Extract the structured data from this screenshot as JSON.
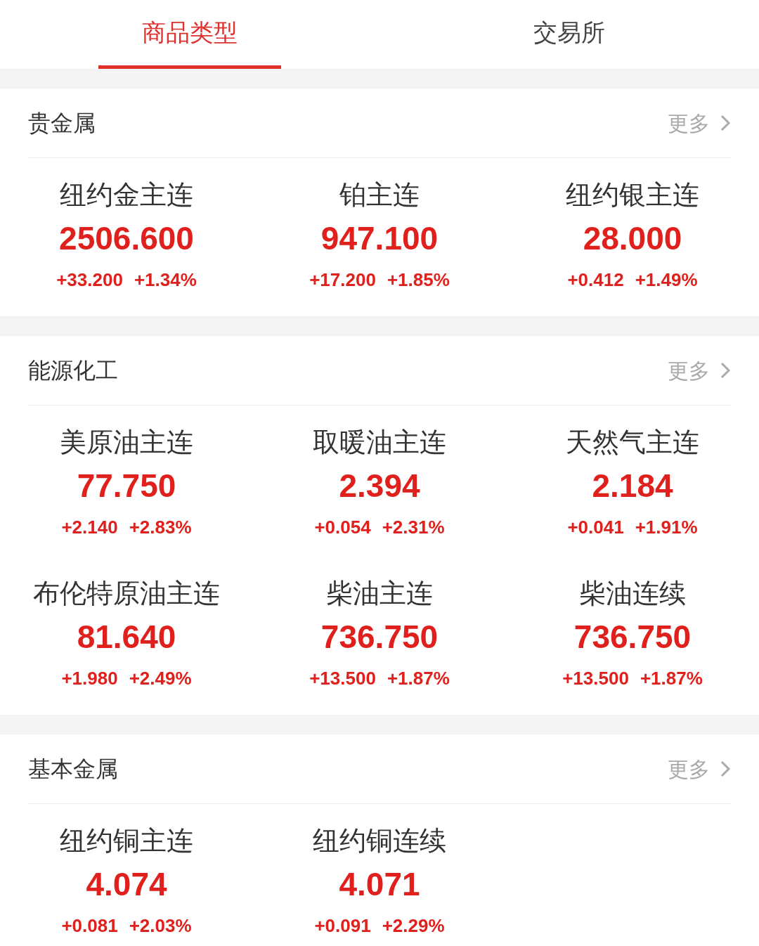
{
  "tabs": [
    {
      "label": "商品类型",
      "selected": true
    },
    {
      "label": "交易所",
      "selected": false
    }
  ],
  "sections": [
    {
      "title": "贵金属",
      "more": "更多",
      "items": [
        {
          "name": "纽约金主连",
          "price": "2506.600",
          "change": "+33.200",
          "percent": "+1.34%"
        },
        {
          "name": "铂主连",
          "price": "947.100",
          "change": "+17.200",
          "percent": "+1.85%"
        },
        {
          "name": "纽约银主连",
          "price": "28.000",
          "change": "+0.412",
          "percent": "+1.49%"
        }
      ]
    },
    {
      "title": "能源化工",
      "more": "更多",
      "items": [
        {
          "name": "美原油主连",
          "price": "77.750",
          "change": "+2.140",
          "percent": "+2.83%"
        },
        {
          "name": "取暖油主连",
          "price": "2.394",
          "change": "+0.054",
          "percent": "+2.31%"
        },
        {
          "name": "天然气主连",
          "price": "2.184",
          "change": "+0.041",
          "percent": "+1.91%"
        },
        {
          "name": "布伦特原油主连",
          "price": "81.640",
          "change": "+1.980",
          "percent": "+2.49%"
        },
        {
          "name": "柴油主连",
          "price": "736.750",
          "change": "+13.500",
          "percent": "+1.87%"
        },
        {
          "name": "柴油连续",
          "price": "736.750",
          "change": "+13.500",
          "percent": "+1.87%"
        }
      ]
    },
    {
      "title": "基本金属",
      "more": "更多",
      "items": [
        {
          "name": "纽约铜主连",
          "price": "4.074",
          "change": "+0.081",
          "percent": "+2.03%"
        },
        {
          "name": "纽约铜连续",
          "price": "4.071",
          "change": "+0.091",
          "percent": "+2.29%"
        }
      ]
    }
  ]
}
